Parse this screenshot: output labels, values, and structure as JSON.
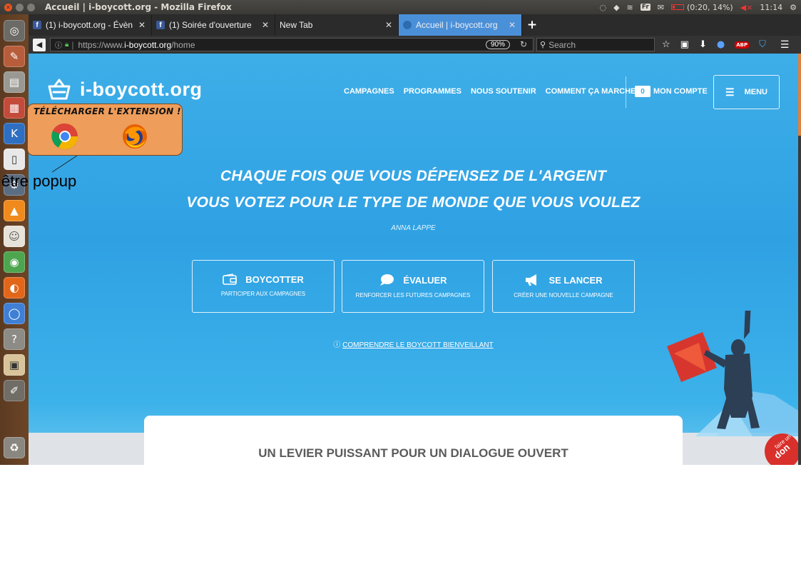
{
  "window": {
    "title": "Accueil | i-boycott.org - Mozilla Firefox",
    "battery_text": "(0:20, 14%)",
    "keyboard_layout": "Fr",
    "clock": "11:14"
  },
  "tabs": [
    {
      "label": "(1) i-boycott.org - Évèn",
      "icon": "facebook-icon",
      "active": false
    },
    {
      "label": "(1) Soirée d'ouverture",
      "icon": "facebook-icon",
      "active": false
    },
    {
      "label": "New Tab",
      "icon": "",
      "active": false
    },
    {
      "label": "Accueil | i-boycott.org",
      "icon": "site-icon",
      "active": true
    }
  ],
  "navbar": {
    "url_prefix": "https://www.",
    "url_domain": "i-boycott.org",
    "url_path": "/home",
    "zoom": "90%",
    "search_placeholder": "Search"
  },
  "site": {
    "logo_text": "i-boycott.org",
    "nav": [
      "CAMPAGNES",
      "PROGRAMMES",
      "NOUS SOUTENIR",
      "COMMENT ÇA MARCHE"
    ],
    "account_count": "0",
    "account_label": "MON COMPTE",
    "menu_label": "MENU",
    "tagline_line1": "CHAQUE FOIS QUE VOUS DÉPENSEZ DE L'ARGENT",
    "tagline_line2": "VOUS VOTEZ POUR LE TYPE DE MONDE QUE VOUS VOULEZ",
    "author": "ANNA LAPPE",
    "ctas": [
      {
        "title": "BOYCOTTER",
        "subtitle": "PARTICIPER AUX CAMPAGNES",
        "icon": "wallet-icon"
      },
      {
        "title": "ÉVALUER",
        "subtitle": "RENFORCER LES FUTURES CAMPAGNES",
        "icon": "speech-bubble-icon"
      },
      {
        "title": "SE LANCER",
        "subtitle": "CRÉER UNE NOUVELLE CAMPAGNE",
        "icon": "megaphone-icon"
      }
    ],
    "understand_icon": "ⓘ",
    "understand_link": "COMPRENDRE LE BOYCOTT BIENVEILLANT",
    "card_title": "UN LEVIER PUISSANT POUR UN DIALOGUE OUVERT",
    "donate_badge_line1": "faire un",
    "donate_badge_line2": "don"
  },
  "popup": {
    "title": "TÉLÉCHARGER L'EXTENSION !",
    "label": "être popup",
    "browsers": [
      "chrome-icon",
      "firefox-icon"
    ]
  },
  "colors": {
    "site_blue": "#3eaee8",
    "popup_orange": "#ee9d5a",
    "active_tab": "#4a90d9",
    "ubuntu_orange": "#e95420"
  }
}
